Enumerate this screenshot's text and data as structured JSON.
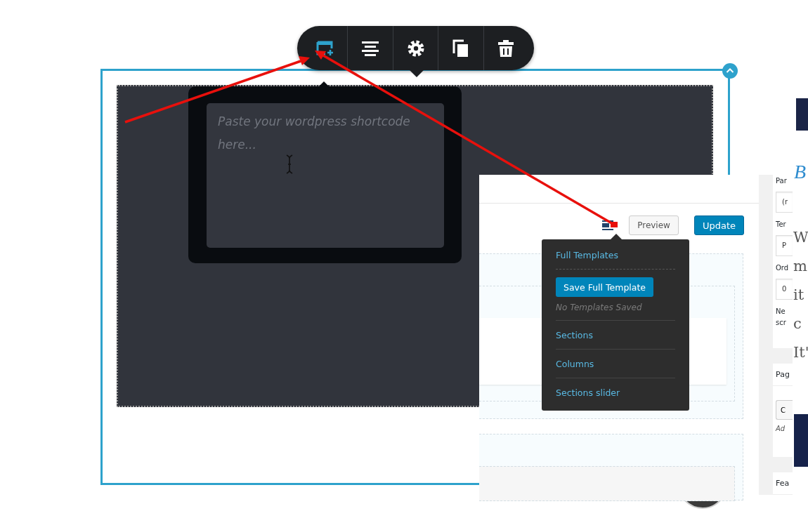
{
  "toolbar": {
    "buttons": [
      {
        "kind": "add-section",
        "selected": true
      },
      {
        "kind": "align",
        "selected": false
      },
      {
        "kind": "settings",
        "selected": false
      },
      {
        "kind": "copy",
        "selected": false
      },
      {
        "kind": "delete",
        "selected": false
      }
    ]
  },
  "shortcode_popup": {
    "placeholder": "Paste your wordpress shortcode here..."
  },
  "admin_panel": {
    "buttons": [
      {
        "label": "Preview",
        "kind": "secondary"
      },
      {
        "label": "Update",
        "kind": "primary"
      }
    ],
    "template_menu": {
      "items": [
        {
          "kind": "link",
          "label": "Full Templates"
        },
        {
          "kind": "button",
          "label": "Save Full Template"
        },
        {
          "kind": "note",
          "label": "No Templates Saved"
        },
        {
          "kind": "link",
          "label": "Sections"
        },
        {
          "kind": "link",
          "label": "Columns"
        },
        {
          "kind": "link",
          "label": "Sections slider"
        }
      ]
    }
  },
  "sidebar": {
    "boxes": [
      {
        "items": [
          {
            "kind": "label",
            "text": "Par"
          },
          {
            "kind": "input",
            "text": "(r"
          },
          {
            "kind": "label",
            "text": "Ter"
          },
          {
            "kind": "input",
            "text": "P"
          },
          {
            "kind": "label",
            "text": "Ord"
          },
          {
            "kind": "input",
            "text": "0"
          },
          {
            "kind": "label",
            "text": "Ne"
          },
          {
            "kind": "label",
            "text": "scr"
          }
        ]
      },
      {
        "items": [
          {
            "kind": "header",
            "text": "Pag"
          },
          {
            "kind": "button",
            "text": "C"
          },
          {
            "kind": "note",
            "text": "Ad"
          }
        ]
      },
      {
        "items": [
          {
            "kind": "header",
            "text": "Fea"
          }
        ]
      }
    ]
  },
  "background_page": {
    "subtitle": "B",
    "text_lines": [
      "W",
      "m",
      "it",
      "c",
      "It'"
    ]
  }
}
